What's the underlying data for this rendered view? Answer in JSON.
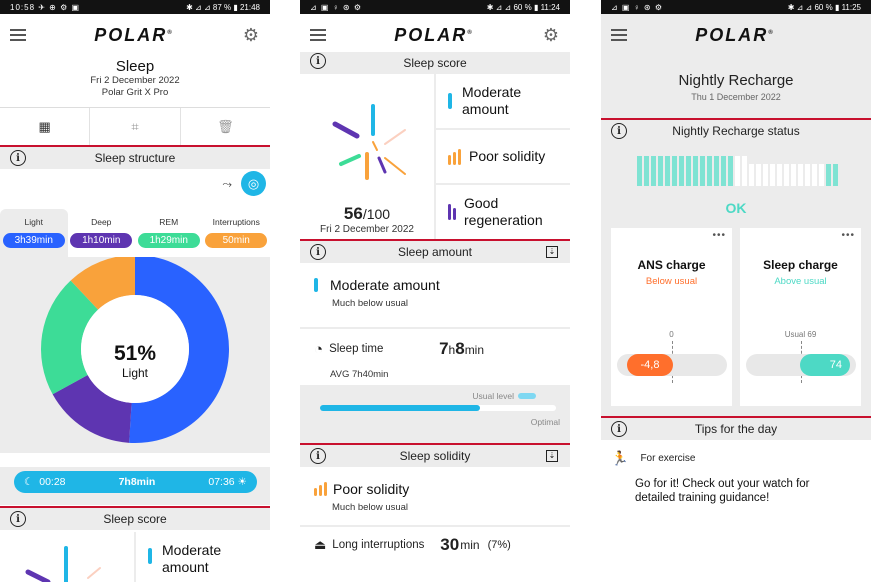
{
  "screens": [
    {
      "status_left": "10:58 ✈ ⊕ ⚙ ▣",
      "status_right": "✱ ⊿ ⊿ 87 % ▮ 21:48",
      "logo": "POLAR",
      "title": "Sleep",
      "date": "Fri 2 December 2022",
      "device": "Polar Grit X Pro",
      "section_structure": "Sleep structure",
      "tabs": [
        {
          "label": "Light",
          "value": "3h39min",
          "color": "#2962ff"
        },
        {
          "label": "Deep",
          "value": "1h10min",
          "color": "#5e35b1"
        },
        {
          "label": "REM",
          "value": "1h29min",
          "color": "#3ddc97"
        },
        {
          "label": "Interruptions",
          "value": "50min",
          "color": "#f9a23b"
        }
      ],
      "donut": {
        "percent": "51%",
        "label": "Light",
        "segments": [
          {
            "name": "Light",
            "fraction": 0.51,
            "color": "#2962ff"
          },
          {
            "name": "Deep",
            "fraction": 0.16,
            "color": "#5e35b1"
          },
          {
            "name": "REM",
            "fraction": 0.21,
            "color": "#3ddc97"
          },
          {
            "name": "Interruptions",
            "fraction": 0.12,
            "color": "#f9a23b"
          }
        ]
      },
      "sleep_start": "00:28",
      "sleep_total": "7h8min",
      "sleep_end": "07:36",
      "section_score": "Sleep score",
      "score_tile": "Moderate amount"
    },
    {
      "status_left": "⊿ ▣ ♀ ⊛ ⚙",
      "status_right": "✱ ⊿ ⊿ 60 % ▮ 11:24",
      "logo": "POLAR",
      "section_score": "Sleep score",
      "score": "56",
      "score_max": "/100",
      "date": "Fri 2 December 2022",
      "tiles": [
        {
          "label": "Moderate amount",
          "color": "#1fb6e6"
        },
        {
          "label": "Poor solidity",
          "color": "#f9a23b"
        },
        {
          "label": "Good regeneration",
          "color": "#5e35b1"
        }
      ],
      "section_amount": "Sleep amount",
      "amount_title": "Moderate amount",
      "amount_sub": "Much below usual",
      "sleep_time_label": "Sleep time",
      "sleep_time_h": "7",
      "sleep_time_hu": "h",
      "sleep_time_m": "8",
      "sleep_time_mu": "min",
      "avg": "AVG 7h40min",
      "usual_level": "Usual level",
      "optimal": "Optimal",
      "amount_progress": 0.68,
      "section_solidity": "Sleep solidity",
      "solidity_title": "Poor solidity",
      "solidity_sub": "Much below usual",
      "interrupt_label": "Long interruptions",
      "interrupt_value": "30",
      "interrupt_unit": "min",
      "interrupt_pct": "(7%)"
    },
    {
      "status_left": "⊿ ▣ ♀ ⊛ ⚙",
      "status_right": "✱ ⊿ ⊿ 60 % ▮ 11:25",
      "logo": "POLAR",
      "title": "Nightly Recharge",
      "date": "Thu 1 December 2022",
      "section_status": "Nightly Recharge status",
      "status": "OK",
      "ans_title": "ANS charge",
      "ans_sub": "Below usual",
      "ans_zero": "0",
      "ans_value": "-4,8",
      "sleep_title": "Sleep charge",
      "sleep_sub": "Above usual",
      "sleep_usual": "Usual 69",
      "sleep_value": "74",
      "section_tips": "Tips for the day",
      "tip_cat": "For exercise",
      "tip_text": "Go for it! Check out your watch for detailed training guidance!"
    }
  ]
}
